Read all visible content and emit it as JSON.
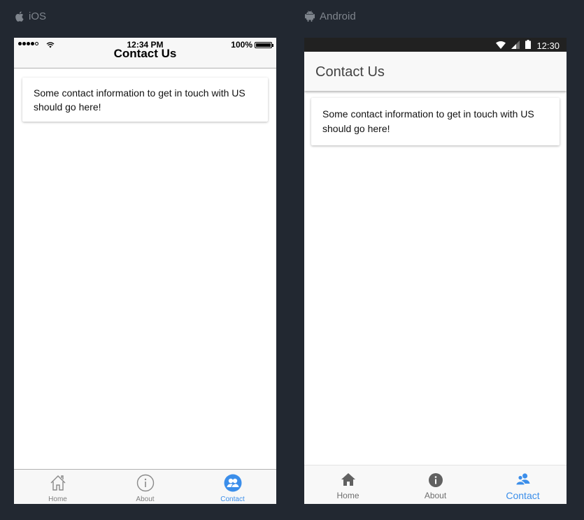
{
  "platforms": {
    "ios_label": "iOS",
    "android_label": "Android"
  },
  "ios": {
    "status": {
      "time": "12:34 PM",
      "battery": "100%"
    },
    "title": "Contact Us",
    "card_text": "Some contact information to get in touch with US should go here!",
    "tabs": [
      {
        "label": "Home",
        "icon": "home-outline-icon",
        "active": false
      },
      {
        "label": "About",
        "icon": "info-circle-outline-icon",
        "active": false
      },
      {
        "label": "Contact",
        "icon": "contacts-filled-icon",
        "active": true
      }
    ]
  },
  "android": {
    "status": {
      "time": "12:30"
    },
    "title": "Contact Us",
    "card_text": "Some contact information to get in touch with US should go here!",
    "tabs": [
      {
        "label": "Home",
        "icon": "home-icon",
        "active": false
      },
      {
        "label": "About",
        "icon": "info-icon",
        "active": false
      },
      {
        "label": "Contact",
        "icon": "contacts-icon",
        "active": true
      }
    ]
  },
  "colors": {
    "background": "#222831",
    "active_tab": "#3b8eea",
    "inactive_tab": "#7f7f7f"
  }
}
